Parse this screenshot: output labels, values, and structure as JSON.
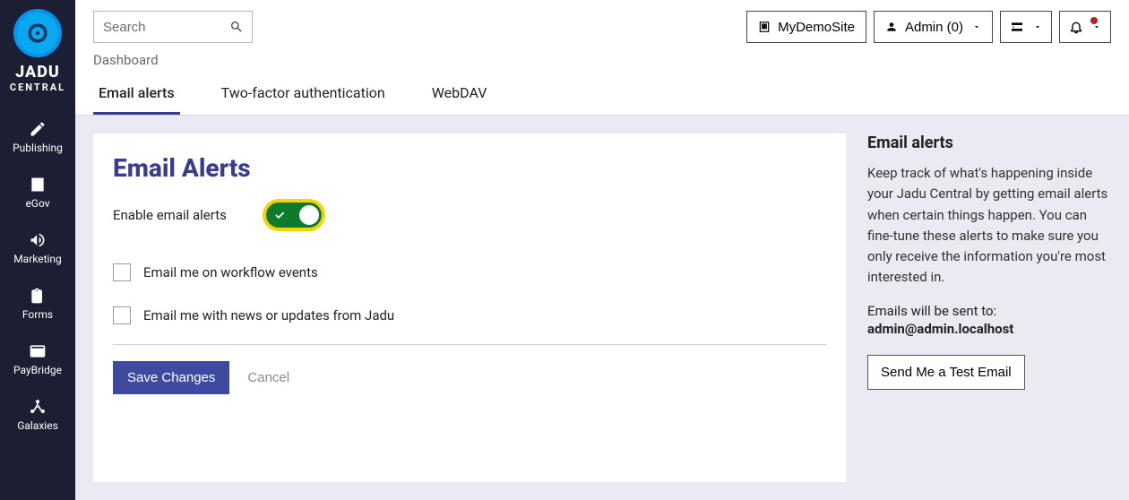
{
  "brand": {
    "line1": "JADU",
    "line2": "CENTRAL"
  },
  "sidebar": {
    "items": [
      {
        "label": "Publishing",
        "icon": "pencil-icon"
      },
      {
        "label": "eGov",
        "icon": "building-icon"
      },
      {
        "label": "Marketing",
        "icon": "megaphone-icon"
      },
      {
        "label": "Forms",
        "icon": "clipboard-icon"
      },
      {
        "label": "PayBridge",
        "icon": "card-icon"
      },
      {
        "label": "Galaxies",
        "icon": "network-icon"
      }
    ]
  },
  "search": {
    "placeholder": "Search"
  },
  "topbar": {
    "site_label": "MyDemoSite",
    "admin_label": "Admin (0)"
  },
  "breadcrumb": "Dashboard",
  "tabs": [
    {
      "label": "Email alerts"
    },
    {
      "label": "Two-factor authentication"
    },
    {
      "label": "WebDAV"
    }
  ],
  "card": {
    "title": "Email Alerts",
    "enable_label": "Enable email alerts",
    "options": [
      {
        "label": "Email me on workflow events"
      },
      {
        "label": "Email me with news or updates from Jadu"
      }
    ],
    "save": "Save Changes",
    "cancel": "Cancel"
  },
  "sideinfo": {
    "heading": "Email alerts",
    "body": "Keep track of what's happening inside your Jadu Central by getting email alerts when certain things happen. You can fine-tune these alerts to make sure you only receive the information you're most interested in.",
    "sent_to_label": "Emails will be sent to:",
    "email": "admin@admin.localhost",
    "test_button": "Send Me a Test Email"
  }
}
